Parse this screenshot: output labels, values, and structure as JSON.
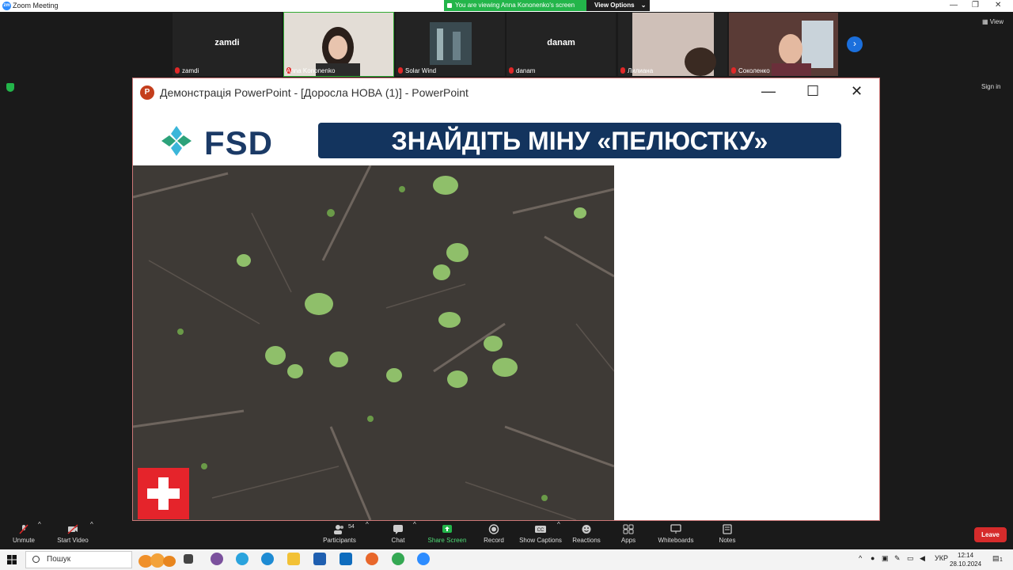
{
  "window": {
    "title": "Zoom Meeting"
  },
  "share_banner": {
    "text": "You are viewing Anna Kononenko's screen",
    "view_options": "View Options"
  },
  "top_right": {
    "view_label": "View",
    "signin_label": "Sign in"
  },
  "gallery": [
    {
      "name": "zamdi",
      "label": "zamdi",
      "video": false
    },
    {
      "name": "",
      "label": "Anna Kononenko",
      "video": true
    },
    {
      "name": "",
      "label": "Solar Wind",
      "video": true
    },
    {
      "name": "danam",
      "label": "danam",
      "video": false
    },
    {
      "name": "",
      "label": "Лилиана",
      "video": true
    },
    {
      "name": "",
      "label": "Соколенко",
      "video": true
    }
  ],
  "ppt": {
    "title": "Демонстрація PowerPoint - [Доросла НОВА (1)] - PowerPoint",
    "logo_text": "FSD",
    "headline": "ЗНАЙДІТЬ МІНУ «ПЕЛЮСТКУ»"
  },
  "toolbar": {
    "unmute": "Unmute",
    "start_video": "Start Video",
    "participants": "Participants",
    "participants_count": "54",
    "chat": "Chat",
    "share_screen": "Share Screen",
    "record": "Record",
    "show_captions": "Show Captions",
    "reactions": "Reactions",
    "apps": "Apps",
    "whiteboards": "Whiteboards",
    "notes": "Notes",
    "leave": "Leave"
  },
  "taskbar": {
    "search_placeholder": "Пошук",
    "language": "УКР",
    "time": "12:14",
    "date": "28.10.2024",
    "notification_count": "1"
  },
  "colors": {
    "zoom_blue": "#2d8cff",
    "share_green": "#23b54a",
    "leave_red": "#d62b2b",
    "slide_navy": "#13345e"
  }
}
